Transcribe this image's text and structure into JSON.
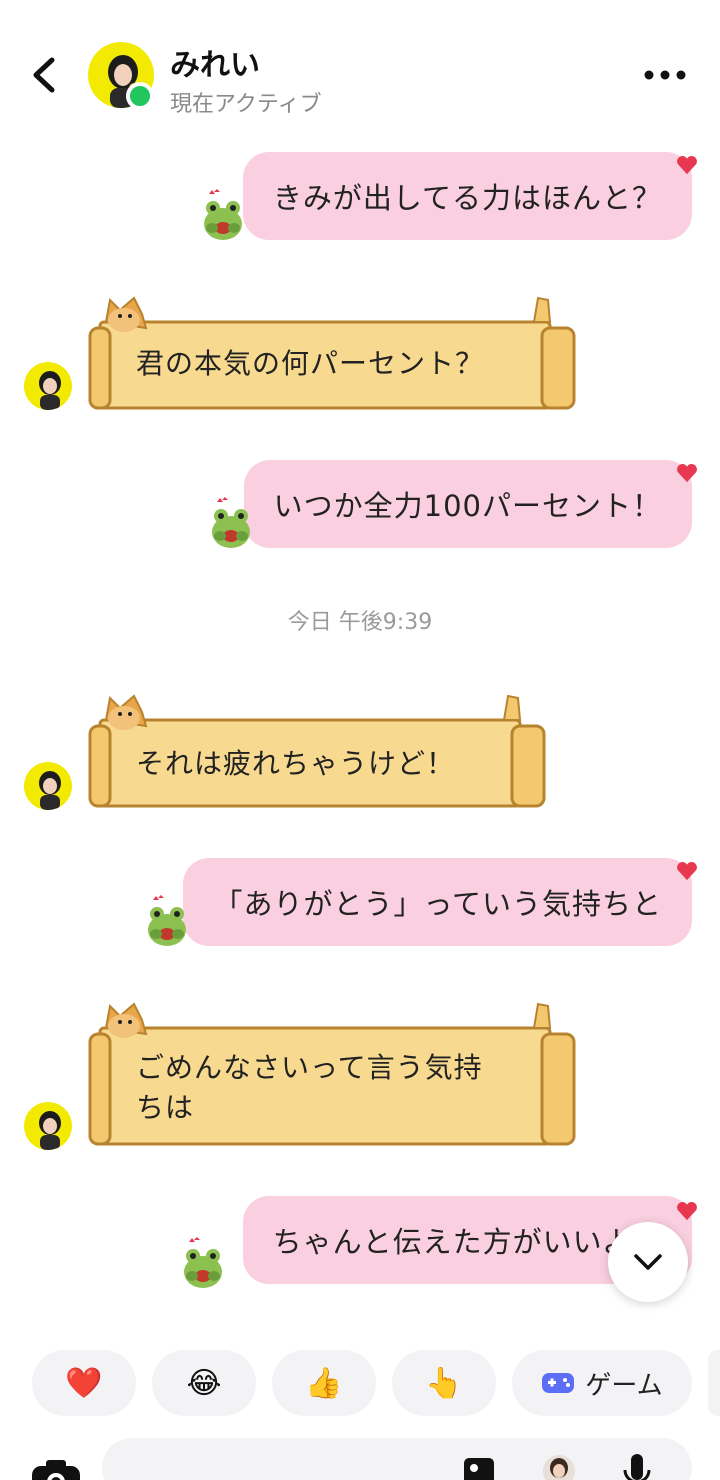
{
  "header": {
    "contact_name": "みれい",
    "status": "現在アクティブ"
  },
  "messages": [
    {
      "dir": "out",
      "text": "きみが出してる力はほんと？"
    },
    {
      "dir": "in",
      "text": "君の本気の何パーセント？"
    },
    {
      "dir": "out",
      "text": "いつか全力100パーセント！"
    },
    {
      "dir": "in",
      "text": "それは疲れちゃうけど！"
    },
    {
      "dir": "out",
      "text": "「ありがとう」っていう気持ちと"
    },
    {
      "dir": "in",
      "text_line1": "ごめんなさいって言う気持",
      "text_line2": "ちは"
    },
    {
      "dir": "out",
      "text": "ちゃんと伝えた方がいいよ！"
    }
  ],
  "timestamp": "今日 午後9:39",
  "reactions": [
    {
      "icon": "heart-icon",
      "glyph": "❤️"
    },
    {
      "icon": "laughing-emoji-icon",
      "glyph": "😂"
    },
    {
      "icon": "thumbs-up-icon",
      "glyph": "👍"
    },
    {
      "icon": "pointing-hand-icon",
      "glyph": "👆"
    },
    {
      "icon": "game-controller-icon",
      "label": "ゲーム"
    }
  ],
  "colors": {
    "outgoing_bubble": "#fad0e0",
    "scroll_bubble": "#f7d990",
    "online": "#22c55e",
    "avatar_bg": "#f2ea00"
  }
}
